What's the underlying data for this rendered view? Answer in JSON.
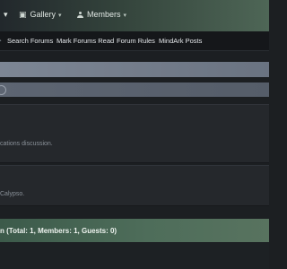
{
  "top_nav": {
    "gallery_label": "Gallery",
    "members_label": "Members",
    "left_chevron": "▾",
    "gallery_chevron": "▾",
    "members_chevron": "▾"
  },
  "sub_nav": {
    "items": [
      "Search Forums",
      "Mark Forums Read",
      "Forum Rules",
      "MindArk Posts"
    ]
  },
  "forums": [
    {
      "description": "cations discussion."
    },
    {
      "description": "Calypso."
    }
  ],
  "online_section": {
    "title": "n (Total: 1, Members: 1, Guests: 0)"
  },
  "colors": {
    "nav_gradient_end": "#4e6656",
    "online_bar": "#4e6d5a",
    "content_bg": "#25282c"
  }
}
